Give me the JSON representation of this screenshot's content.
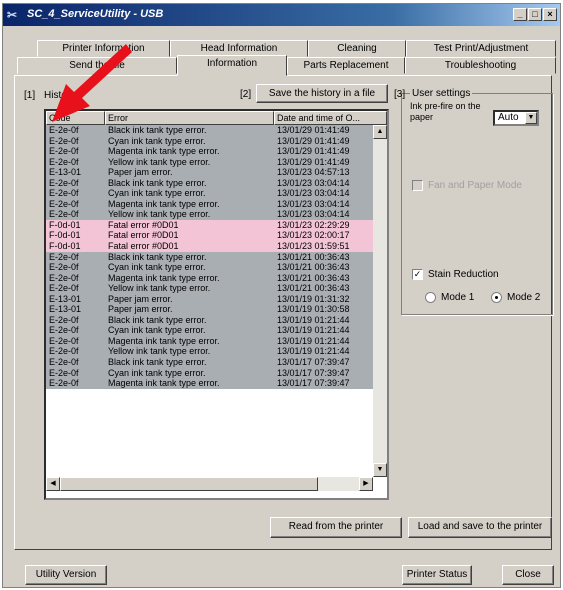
{
  "window": {
    "title": "SC_4_ServiceUtility - USB",
    "min": "_",
    "max": "□",
    "close": "×"
  },
  "tabs": {
    "row1": [
      "Printer Information",
      "Head Information",
      "Cleaning",
      "Test Print/Adjustment"
    ],
    "row2": [
      "Send the file",
      "Information",
      "Parts Replacement",
      "Troubleshooting"
    ]
  },
  "history": {
    "section_num": "[1]",
    "label": "History",
    "columns": [
      "Code",
      "Error",
      "Date and time of O..."
    ],
    "rows": [
      {
        "code": "E-2e-0f",
        "error": "Black ink tank type error.",
        "date": "13/01/29 01:41:49",
        "hl": false
      },
      {
        "code": "E-2e-0f",
        "error": "Cyan ink tank type error.",
        "date": "13/01/29 01:41:49",
        "hl": false
      },
      {
        "code": "E-2e-0f",
        "error": "Magenta ink tank type error.",
        "date": "13/01/29 01:41:49",
        "hl": false
      },
      {
        "code": "E-2e-0f",
        "error": "Yellow ink tank type error.",
        "date": "13/01/29 01:41:49",
        "hl": false
      },
      {
        "code": "E-13-01",
        "error": "Paper jam error.",
        "date": "13/01/23 04:57:13",
        "hl": false
      },
      {
        "code": "E-2e-0f",
        "error": "Black ink tank type error.",
        "date": "13/01/23 03:04:14",
        "hl": false
      },
      {
        "code": "E-2e-0f",
        "error": "Cyan ink tank type error.",
        "date": "13/01/23 03:04:14",
        "hl": false
      },
      {
        "code": "E-2e-0f",
        "error": "Magenta ink tank type error.",
        "date": "13/01/23 03:04:14",
        "hl": false
      },
      {
        "code": "E-2e-0f",
        "error": "Yellow ink tank type error.",
        "date": "13/01/23 03:04:14",
        "hl": false
      },
      {
        "code": "F-0d-01",
        "error": "Fatal error #0D01",
        "date": "13/01/23 02:29:29",
        "hl": true
      },
      {
        "code": "F-0d-01",
        "error": "Fatal error #0D01",
        "date": "13/01/23 02:00:17",
        "hl": true
      },
      {
        "code": "F-0d-01",
        "error": "Fatal error #0D01",
        "date": "13/01/23 01:59:51",
        "hl": true
      },
      {
        "code": "E-2e-0f",
        "error": "Black ink tank type error.",
        "date": "13/01/21 00:36:43",
        "hl": false
      },
      {
        "code": "E-2e-0f",
        "error": "Cyan ink tank type error.",
        "date": "13/01/21 00:36:43",
        "hl": false
      },
      {
        "code": "E-2e-0f",
        "error": "Magenta ink tank type error.",
        "date": "13/01/21 00:36:43",
        "hl": false
      },
      {
        "code": "E-2e-0f",
        "error": "Yellow ink tank type error.",
        "date": "13/01/21 00:36:43",
        "hl": false
      },
      {
        "code": "E-13-01",
        "error": "Paper jam error.",
        "date": "13/01/19 01:31:32",
        "hl": false
      },
      {
        "code": "E-13-01",
        "error": "Paper jam error.",
        "date": "13/01/19 01:30:58",
        "hl": false
      },
      {
        "code": "E-2e-0f",
        "error": "Black ink tank type error.",
        "date": "13/01/19 01:21:44",
        "hl": false
      },
      {
        "code": "E-2e-0f",
        "error": "Cyan ink tank type error.",
        "date": "13/01/19 01:21:44",
        "hl": false
      },
      {
        "code": "E-2e-0f",
        "error": "Magenta ink tank type error.",
        "date": "13/01/19 01:21:44",
        "hl": false
      },
      {
        "code": "E-2e-0f",
        "error": "Yellow ink tank type error.",
        "date": "13/01/19 01:21:44",
        "hl": false
      },
      {
        "code": "E-2e-0f",
        "error": "Black ink tank type error.",
        "date": "13/01/17 07:39:47",
        "hl": false
      },
      {
        "code": "E-2e-0f",
        "error": "Cyan ink tank type error.",
        "date": "13/01/17 07:39:47",
        "hl": false
      },
      {
        "code": "E-2e-0f",
        "error": "Magenta ink tank type error.",
        "date": "13/01/17 07:39:47",
        "hl": false
      }
    ]
  },
  "save_history": {
    "section_num": "[2]",
    "label": "Save the history in a file"
  },
  "user_settings": {
    "section_num": "[3]",
    "title": "User settings",
    "ink_prefire_label": "Ink pre-fire on the paper",
    "ink_prefire_value": "Auto",
    "fan_label": "Fan and Paper Mode",
    "stain_label": "Stain Reduction",
    "mode1": "Mode 1",
    "mode2": "Mode 2"
  },
  "buttons": {
    "read": "Read from the printer",
    "load_save": "Load and save to the printer",
    "utility_version": "Utility Version",
    "printer_status": "Printer Status",
    "close": "Close"
  },
  "colors": {
    "row_gray": "#a9aeb2",
    "row_pink": "#f3c4d6",
    "annotation_arrow": "#e8101a",
    "titlebar": "#0a246a"
  }
}
